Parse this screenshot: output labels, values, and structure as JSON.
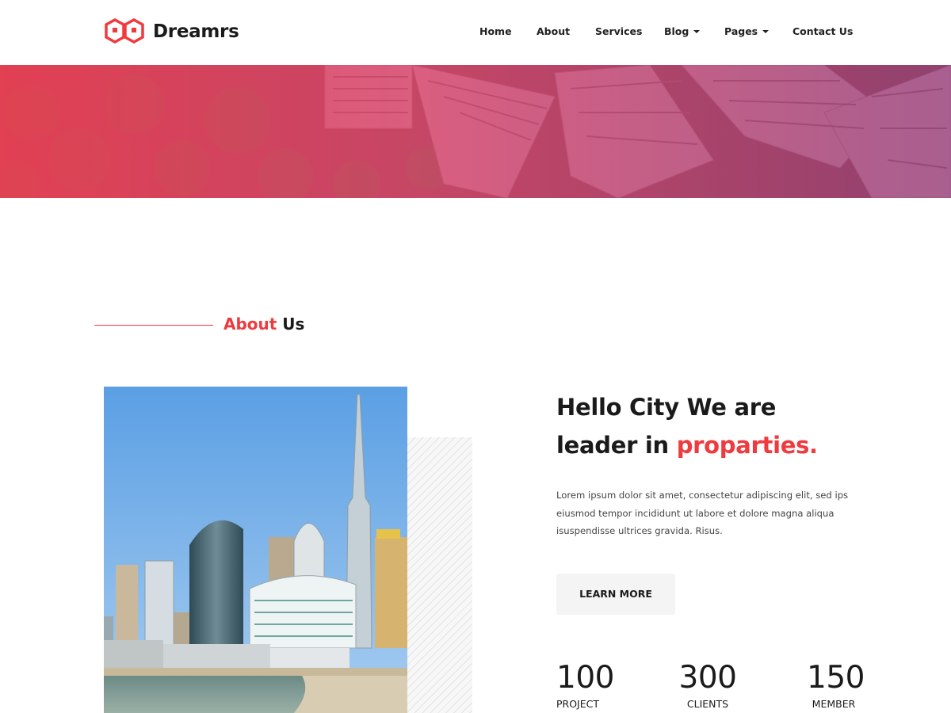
{
  "brand": {
    "name": "Dreamrs",
    "accent_color": "#ef3a3e"
  },
  "nav": {
    "items": [
      {
        "label": "Home",
        "has_dropdown": false
      },
      {
        "label": "About",
        "has_dropdown": false
      },
      {
        "label": "Services",
        "has_dropdown": false
      },
      {
        "label": "Blog",
        "has_dropdown": true
      },
      {
        "label": "Pages",
        "has_dropdown": true
      },
      {
        "label": "Contact Us",
        "has_dropdown": false
      }
    ]
  },
  "about": {
    "title_accent": "About",
    "title_rest": " Us",
    "headline_line1": "Hello City We are",
    "headline_line2_prefix": "leader in ",
    "headline_line2_accent": "proparties.",
    "paragraph": "Lorem ipsum dolor sit amet, consectetur adipiscing elit, sed ips eiusmod tempor incididunt ut labore et dolore magna aliqua isuspendisse ultrices gravida. Risus.",
    "button_label": "LEARN MORE"
  },
  "stats": [
    {
      "value": "100",
      "label": "PROJECT"
    },
    {
      "value": "300",
      "label": "CLIENTS"
    },
    {
      "value": "150",
      "label": "MEMBER"
    }
  ],
  "icons": {
    "logo": "hexagon-houses-logo-icon",
    "dropdown": "caret-down-icon"
  }
}
